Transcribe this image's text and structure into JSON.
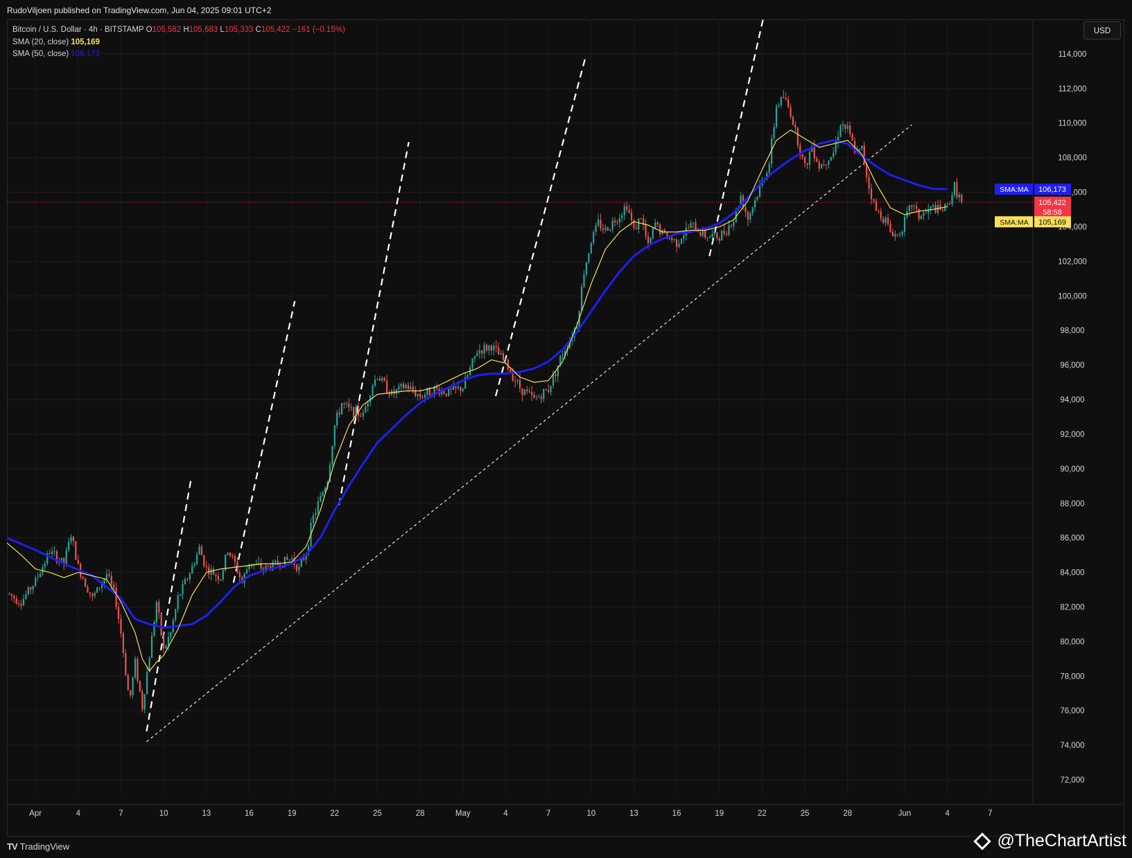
{
  "header": {
    "publisher": "RudoViljoen published on TradingView.com, Jun 04, 2025 09:01 UTC+2"
  },
  "legend": {
    "symbol": "Bitcoin / U.S. Dollar · 4h · BITSTAMP",
    "o_label": "O",
    "o_value": "105,582",
    "h_label": "H",
    "h_value": "105,683",
    "l_label": "L",
    "l_value": "105,333",
    "c_label": "C",
    "c_value": "105,422",
    "change": "−161 (−0.15%)",
    "sma20_label": "SMA (20, close)",
    "sma20_value": "105,169",
    "sma50_label": "SMA (50, close)",
    "sma50_value": "106,173"
  },
  "currency_button": "USD",
  "price_tags": {
    "sma50_name": "SMA:MA",
    "sma50_value": "106,173",
    "last_price": "105,422",
    "countdown": "58:58",
    "sma20_name": "SMA:MA",
    "sma20_value": "105,169"
  },
  "footer": {
    "logo_text": "TradingView",
    "watermark": "@TheChartArtist"
  },
  "colors": {
    "background": "#0f0f0f",
    "up": "#26a69a",
    "down": "#ef5350",
    "sma20": "#f7e05a",
    "sma50": "#1f1ff0",
    "grid": "#1c1c1c",
    "last_price": "#f23645"
  },
  "chart_data": {
    "type": "candlestick",
    "x_ticks": [
      {
        "label": "Apr",
        "day": 1
      },
      {
        "label": "4",
        "day": 4
      },
      {
        "label": "7",
        "day": 7
      },
      {
        "label": "10",
        "day": 10
      },
      {
        "label": "13",
        "day": 13
      },
      {
        "label": "16",
        "day": 16
      },
      {
        "label": "19",
        "day": 19
      },
      {
        "label": "22",
        "day": 22
      },
      {
        "label": "25",
        "day": 25
      },
      {
        "label": "28",
        "day": 28
      },
      {
        "label": "May",
        "day": 31
      },
      {
        "label": "4",
        "day": 34
      },
      {
        "label": "7",
        "day": 37
      },
      {
        "label": "10",
        "day": 40
      },
      {
        "label": "13",
        "day": 43
      },
      {
        "label": "16",
        "day": 46
      },
      {
        "label": "19",
        "day": 49
      },
      {
        "label": "22",
        "day": 52
      },
      {
        "label": "25",
        "day": 55
      },
      {
        "label": "28",
        "day": 58
      },
      {
        "label": "Jun",
        "day": 62
      },
      {
        "label": "4",
        "day": 65
      },
      {
        "label": "7",
        "day": 68
      }
    ],
    "y_ticks": [
      72000,
      74000,
      76000,
      78000,
      80000,
      82000,
      84000,
      86000,
      88000,
      90000,
      92000,
      94000,
      96000,
      98000,
      100000,
      102000,
      104000,
      106000,
      108000,
      110000,
      112000,
      114000
    ],
    "y_tick_labels": [
      "72,000",
      "74,000",
      "76,000",
      "78,000",
      "80,000",
      "82,000",
      "84,000",
      "86,000",
      "88,000",
      "90,000",
      "92,000",
      "94,000",
      "96,000",
      "98,000",
      "100,000",
      "102,000",
      "104,000",
      "106,000",
      "108,000",
      "110,000",
      "112,000",
      "114,000"
    ],
    "y_range": [
      71200,
      116000
    ],
    "x_range_days": [
      -1,
      71
    ],
    "price_keypoints": [
      [
        -1,
        82800
      ],
      [
        0,
        82300
      ],
      [
        1,
        83500
      ],
      [
        2,
        85200
      ],
      [
        3,
        84500
      ],
      [
        3.5,
        86200
      ],
      [
        4,
        84300
      ],
      [
        5,
        82500
      ],
      [
        6,
        83900
      ],
      [
        6.6,
        82600
      ],
      [
        7,
        80500
      ],
      [
        7.6,
        76500
      ],
      [
        8,
        78800
      ],
      [
        8.5,
        76200
      ],
      [
        9,
        79200
      ],
      [
        9.5,
        82300
      ],
      [
        10,
        79500
      ],
      [
        10.5,
        80500
      ],
      [
        11,
        82500
      ],
      [
        12,
        84300
      ],
      [
        12.5,
        85400
      ],
      [
        13,
        84200
      ],
      [
        14,
        83700
      ],
      [
        14.5,
        85300
      ],
      [
        15,
        84500
      ],
      [
        15.5,
        83400
      ],
      [
        16,
        84600
      ],
      [
        17,
        84200
      ],
      [
        18,
        84500
      ],
      [
        19,
        84800
      ],
      [
        19.5,
        84200
      ],
      [
        20,
        85200
      ],
      [
        20.5,
        87200
      ],
      [
        21,
        88300
      ],
      [
        21.5,
        89400
      ],
      [
        22,
        92500
      ],
      [
        22.5,
        93800
      ],
      [
        23,
        93400
      ],
      [
        24,
        93100
      ],
      [
        24.6,
        94800
      ],
      [
        25,
        95400
      ],
      [
        26,
        94300
      ],
      [
        27,
        94800
      ],
      [
        28,
        94200
      ],
      [
        29,
        94600
      ],
      [
        30,
        94400
      ],
      [
        31,
        94700
      ],
      [
        32,
        96800
      ],
      [
        33,
        97100
      ],
      [
        34,
        96100
      ],
      [
        35,
        94700
      ],
      [
        36,
        94000
      ],
      [
        37,
        94600
      ],
      [
        38,
        96700
      ],
      [
        38.5,
        97500
      ],
      [
        39,
        98400
      ],
      [
        39.5,
        101400
      ],
      [
        40,
        103200
      ],
      [
        40.5,
        104200
      ],
      [
        41,
        103800
      ],
      [
        42,
        104700
      ],
      [
        42.5,
        105300
      ],
      [
        43,
        103800
      ],
      [
        43.5,
        104600
      ],
      [
        44,
        102800
      ],
      [
        44.5,
        104200
      ],
      [
        45,
        103600
      ],
      [
        46,
        103100
      ],
      [
        46.5,
        103600
      ],
      [
        47,
        104100
      ],
      [
        48,
        103500
      ],
      [
        49,
        103400
      ],
      [
        50,
        104400
      ],
      [
        50.5,
        105800
      ],
      [
        51,
        104500
      ],
      [
        52,
        106600
      ],
      [
        52.5,
        107700
      ],
      [
        53,
        111000
      ],
      [
        53.5,
        111500
      ],
      [
        54,
        110600
      ],
      [
        55,
        107400
      ],
      [
        55.5,
        108700
      ],
      [
        56,
        107500
      ],
      [
        57,
        108300
      ],
      [
        57.5,
        110000
      ],
      [
        58,
        109600
      ],
      [
        58.6,
        108200
      ],
      [
        59,
        108500
      ],
      [
        59.5,
        106300
      ],
      [
        60,
        104900
      ],
      [
        60.6,
        104500
      ],
      [
        61,
        103700
      ],
      [
        61.5,
        103500
      ],
      [
        62,
        104300
      ],
      [
        62.5,
        105300
      ],
      [
        63,
        104600
      ],
      [
        63.5,
        104800
      ],
      [
        64,
        105100
      ],
      [
        64.5,
        104900
      ],
      [
        65,
        105200
      ],
      [
        65.5,
        106300
      ],
      [
        66,
        105422
      ]
    ],
    "sma20_keypoints": [
      [
        -1,
        85700
      ],
      [
        0,
        85000
      ],
      [
        1,
        84200
      ],
      [
        2,
        84000
      ],
      [
        3,
        83700
      ],
      [
        4,
        84000
      ],
      [
        5,
        83800
      ],
      [
        6,
        83600
      ],
      [
        7,
        82300
      ],
      [
        8,
        80500
      ],
      [
        8.5,
        79000
      ],
      [
        9,
        78300
      ],
      [
        9.5,
        78800
      ],
      [
        10,
        79200
      ],
      [
        11,
        80700
      ],
      [
        12,
        82700
      ],
      [
        13,
        84000
      ],
      [
        14,
        84200
      ],
      [
        15,
        84300
      ],
      [
        16,
        84400
      ],
      [
        17,
        84500
      ],
      [
        18,
        84500
      ],
      [
        19,
        84600
      ],
      [
        20,
        85500
      ],
      [
        21,
        87600
      ],
      [
        22,
        90400
      ],
      [
        23,
        92500
      ],
      [
        24,
        93700
      ],
      [
        25,
        94300
      ],
      [
        26,
        94400
      ],
      [
        27,
        94500
      ],
      [
        28,
        94500
      ],
      [
        29,
        94700
      ],
      [
        30,
        95100
      ],
      [
        31,
        95500
      ],
      [
        32,
        95800
      ],
      [
        33,
        96300
      ],
      [
        34,
        96100
      ],
      [
        35,
        95300
      ],
      [
        36,
        95000
      ],
      [
        37,
        95100
      ],
      [
        38,
        96200
      ],
      [
        39,
        98300
      ],
      [
        40,
        100700
      ],
      [
        41,
        102700
      ],
      [
        42,
        103700
      ],
      [
        43,
        104300
      ],
      [
        44,
        104100
      ],
      [
        45,
        103700
      ],
      [
        46,
        103700
      ],
      [
        47,
        103800
      ],
      [
        48,
        103800
      ],
      [
        49,
        104000
      ],
      [
        50,
        104400
      ],
      [
        51,
        105500
      ],
      [
        52,
        107300
      ],
      [
        53,
        109000
      ],
      [
        54,
        109600
      ],
      [
        55,
        109100
      ],
      [
        56,
        108600
      ],
      [
        57,
        108800
      ],
      [
        58,
        109000
      ],
      [
        59,
        108200
      ],
      [
        60,
        106500
      ],
      [
        61,
        105100
      ],
      [
        62,
        104700
      ],
      [
        63,
        104900
      ],
      [
        64,
        105000
      ],
      [
        65,
        105169
      ]
    ],
    "sma50_keypoints": [
      [
        -1,
        86000
      ],
      [
        1,
        85300
      ],
      [
        3,
        84500
      ],
      [
        5,
        83800
      ],
      [
        7,
        82500
      ],
      [
        8,
        81300
      ],
      [
        9,
        81000
      ],
      [
        10,
        80800
      ],
      [
        12,
        81000
      ],
      [
        13,
        81500
      ],
      [
        14,
        82300
      ],
      [
        15,
        83200
      ],
      [
        16,
        83800
      ],
      [
        17,
        84100
      ],
      [
        18,
        84300
      ],
      [
        19,
        84500
      ],
      [
        20,
        85000
      ],
      [
        21,
        86000
      ],
      [
        22,
        87600
      ],
      [
        23,
        89000
      ],
      [
        24,
        90300
      ],
      [
        25,
        91500
      ],
      [
        26,
        92300
      ],
      [
        27,
        93100
      ],
      [
        28,
        93800
      ],
      [
        29,
        94300
      ],
      [
        30,
        94700
      ],
      [
        31,
        95100
      ],
      [
        32,
        95400
      ],
      [
        33,
        95500
      ],
      [
        34,
        95500
      ],
      [
        35,
        95600
      ],
      [
        36,
        95800
      ],
      [
        37,
        96200
      ],
      [
        38,
        96900
      ],
      [
        39,
        97900
      ],
      [
        40,
        99100
      ],
      [
        41,
        100300
      ],
      [
        42,
        101400
      ],
      [
        43,
        102300
      ],
      [
        44,
        102900
      ],
      [
        45,
        103300
      ],
      [
        46,
        103600
      ],
      [
        47,
        103700
      ],
      [
        48,
        103900
      ],
      [
        49,
        104200
      ],
      [
        50,
        104800
      ],
      [
        51,
        105700
      ],
      [
        52,
        106600
      ],
      [
        53,
        107300
      ],
      [
        54,
        107900
      ],
      [
        55,
        108400
      ],
      [
        56,
        108800
      ],
      [
        57,
        109000
      ],
      [
        58,
        108800
      ],
      [
        59,
        108100
      ],
      [
        60,
        107500
      ],
      [
        61,
        107000
      ],
      [
        62,
        106700
      ],
      [
        63,
        106400
      ],
      [
        64,
        106200
      ],
      [
        65,
        106173
      ]
    ],
    "annotations": {
      "trendline_dotted": [
        [
          8.8,
          74200
        ],
        [
          62.5,
          109900
        ]
      ],
      "dashed_legs": [
        [
          [
            8.8,
            74800
          ],
          [
            11.9,
            89300
          ]
        ],
        [
          [
            14.9,
            83400
          ],
          [
            19.2,
            99700
          ]
        ],
        [
          [
            22.3,
            87900
          ],
          [
            27.2,
            108900
          ]
        ],
        [
          [
            33.3,
            94200
          ],
          [
            39.6,
            113800
          ]
        ],
        [
          [
            48.3,
            102300
          ],
          [
            53.3,
            120500
          ]
        ]
      ]
    }
  }
}
